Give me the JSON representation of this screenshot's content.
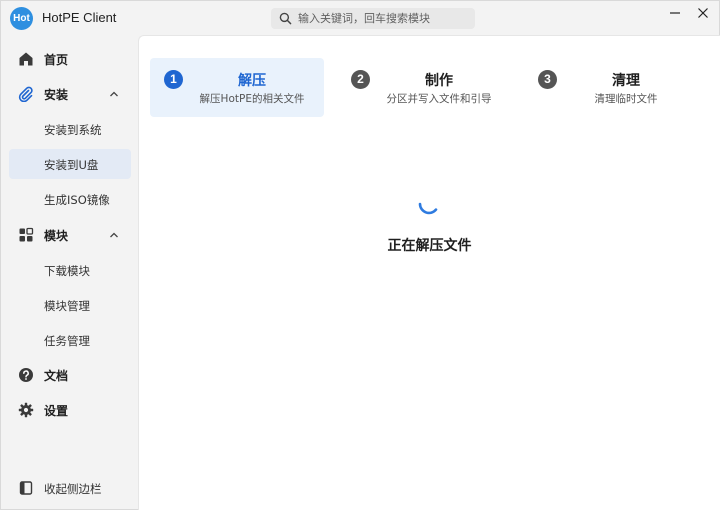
{
  "app": {
    "logo_text": "Hot",
    "title": "HotPE Client"
  },
  "search": {
    "placeholder": "输入关键词，回车搜索模块",
    "value": "",
    "icon": "search-icon"
  },
  "window_controls": {
    "minimize_icon": "minimize-icon",
    "close_icon": "close-icon"
  },
  "sidebar": {
    "home": {
      "label": "首页",
      "icon": "home-icon"
    },
    "install": {
      "label": "安装",
      "icon": "paperclip-icon",
      "expanded": true,
      "items": [
        {
          "label": "安装到系统",
          "active": false
        },
        {
          "label": "安装到U盘",
          "active": true
        },
        {
          "label": "生成ISO镜像",
          "active": false
        }
      ]
    },
    "modules": {
      "label": "模块",
      "icon": "grid-icon",
      "expanded": true,
      "items": [
        {
          "label": "下载模块"
        },
        {
          "label": "模块管理"
        },
        {
          "label": "任务管理"
        }
      ]
    },
    "docs": {
      "label": "文档",
      "icon": "help-circle-icon"
    },
    "settings": {
      "label": "设置",
      "icon": "gear-icon"
    },
    "collapse": {
      "label": "收起侧边栏",
      "icon": "sidebar-collapse-icon"
    }
  },
  "steps": [
    {
      "number": "1",
      "title": "解压",
      "subtitle": "解压HotPE的相关文件",
      "active": true
    },
    {
      "number": "2",
      "title": "制作",
      "subtitle": "分区并写入文件和引导",
      "active": false
    },
    {
      "number": "3",
      "title": "清理",
      "subtitle": "清理临时文件",
      "active": false
    }
  ],
  "status": {
    "text": "正在解压文件",
    "icon": "loading-spinner-icon"
  },
  "colors": {
    "accent": "#1f66d1",
    "step_inactive": "#555555",
    "active_bg": "#e9f2fc",
    "logo": "#2e8fe0"
  }
}
